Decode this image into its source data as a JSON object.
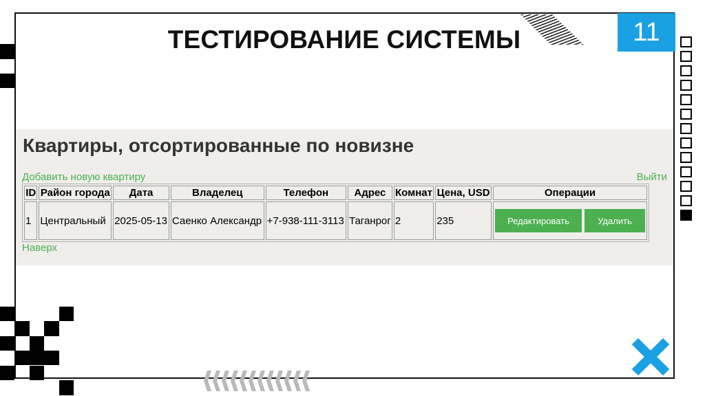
{
  "slide": {
    "title": "ТЕСТИРОВАНИЕ СИСТЕМЫ",
    "page_number": "11"
  },
  "app": {
    "heading": "Квартиры, отсортированные по новизне",
    "add_link": "Добавить новую квартиру",
    "logout_link": "Выйти",
    "top_link": "Наверх",
    "table": {
      "headers": [
        "ID",
        "Район города",
        "Дата",
        "Владелец",
        "Телефон",
        "Адрес",
        "Комнат",
        "Цена, USD",
        "Операции"
      ],
      "rows": [
        {
          "id": "1",
          "district": "Центральный",
          "date": "2025-05-13",
          "owner": "Саенко Александр",
          "phone": "+7-938-111-3113",
          "address": "Таганрог",
          "rooms": "2",
          "price": "235",
          "edit_label": "Редактировать",
          "delete_label": "Удалить"
        }
      ]
    }
  },
  "colors": {
    "accent_green": "#4caf50",
    "page_number_bg": "#1aa1e3",
    "close_icon": "#1aa1e3",
    "app_background": "#efeeeb"
  },
  "icons": {
    "close": "close-icon"
  }
}
